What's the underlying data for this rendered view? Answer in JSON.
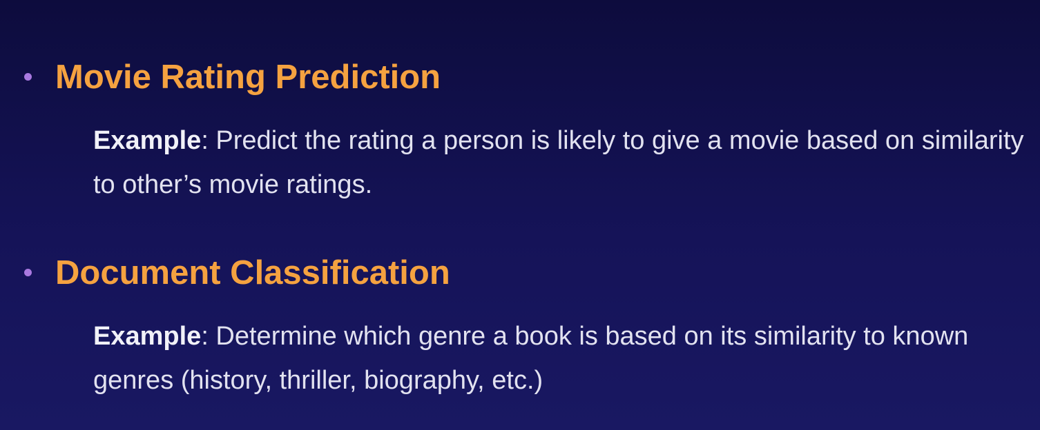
{
  "colors": {
    "background_top": "#0d0c3d",
    "background_bottom": "#191862",
    "heading": "#f5a240",
    "bullet": "#a979e0",
    "body_text": "#e2e2f0"
  },
  "items": [
    {
      "title": "Movie Rating Prediction",
      "label": "Example",
      "text": ": Predict the rating a person is likely to give a movie based on similarity to other’s movie ratings."
    },
    {
      "title": "Document Classification",
      "label": "Example",
      "text": ": Determine which genre a book is based on its similarity to known genres (history, thriller, biography, etc.)"
    }
  ]
}
